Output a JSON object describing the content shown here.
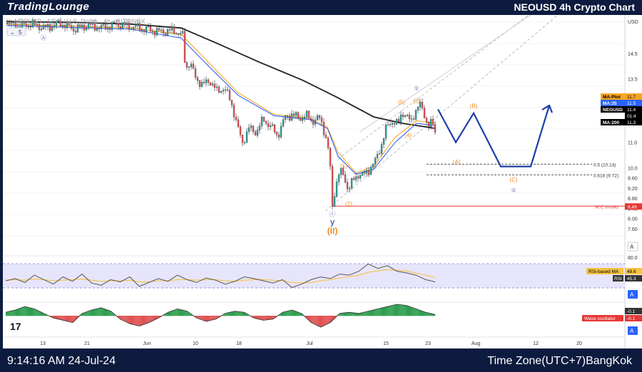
{
  "brand": {
    "logo_text": "TradingLounge",
    "title": "NEOUSD 4h Crypto Chart"
  },
  "footer": {
    "clock": "9:14:16 AM 24-Jul-24",
    "timezone": "Time Zone(UTC+7)BangKok"
  },
  "legend": {
    "symbol_line": "NEOUSD · NEO / U.S. Dollar · 4h · BITFINEX",
    "collapse_count": "5"
  },
  "colors": {
    "up": "#26a69a",
    "down": "#ef5350",
    "ma35": "#2962ff",
    "ma_ptot": "#f6a623",
    "ma200": "#222222",
    "projection": "#1e3fa8",
    "wave_orange": "#f28c28",
    "rsi": "#555555",
    "rsi_ma": "#f5c242",
    "invalid": "#e53935",
    "brand_bg": "#0d1b3e"
  },
  "chart_data": {
    "type": "line",
    "symbol": "NEOUSD",
    "timeframe": "4h",
    "y_axis_label": "USD",
    "ylim": [
      7.6,
      15.9
    ],
    "x_ticks": [
      "13",
      "21",
      "Jun",
      "10",
      "18",
      "Jul",
      "15",
      "23",
      "Aug",
      "12",
      "20"
    ],
    "y_ticks": [
      "14.5",
      "13.5",
      "12.5",
      "11.0",
      "10.0",
      "9.60",
      "9.20",
      "8.80",
      "8.40",
      "8.00",
      "7.60"
    ],
    "price_path": [
      {
        "x": 5,
        "y": 15.7
      },
      {
        "x": 20,
        "y": 15.55
      },
      {
        "x": 40,
        "y": 15.65
      },
      {
        "x": 60,
        "y": 15.5
      },
      {
        "x": 80,
        "y": 15.7
      },
      {
        "x": 100,
        "y": 15.45
      },
      {
        "x": 120,
        "y": 15.6
      },
      {
        "x": 140,
        "y": 15.5
      },
      {
        "x": 160,
        "y": 15.65
      },
      {
        "x": 180,
        "y": 15.55
      },
      {
        "x": 200,
        "y": 15.45
      },
      {
        "x": 220,
        "y": 15.35
      },
      {
        "x": 240,
        "y": 15.4
      },
      {
        "x": 252,
        "y": 15.2
      },
      {
        "x": 256,
        "y": 13.9
      },
      {
        "x": 262,
        "y": 14.15
      },
      {
        "x": 270,
        "y": 13.55
      },
      {
        "x": 280,
        "y": 13.25
      },
      {
        "x": 290,
        "y": 13.45
      },
      {
        "x": 300,
        "y": 13.0
      },
      {
        "x": 310,
        "y": 13.15
      },
      {
        "x": 320,
        "y": 12.6
      },
      {
        "x": 330,
        "y": 11.5
      },
      {
        "x": 336,
        "y": 11.0
      },
      {
        "x": 345,
        "y": 11.55
      },
      {
        "x": 355,
        "y": 11.4
      },
      {
        "x": 365,
        "y": 11.9
      },
      {
        "x": 375,
        "y": 11.65
      },
      {
        "x": 385,
        "y": 11.25
      },
      {
        "x": 395,
        "y": 11.95
      },
      {
        "x": 405,
        "y": 12.1
      },
      {
        "x": 415,
        "y": 11.95
      },
      {
        "x": 425,
        "y": 12.05
      },
      {
        "x": 435,
        "y": 11.85
      },
      {
        "x": 445,
        "y": 11.95
      },
      {
        "x": 452,
        "y": 11.3
      },
      {
        "x": 458,
        "y": 10.45
      },
      {
        "x": 462,
        "y": 8.45
      },
      {
        "x": 466,
        "y": 9.25
      },
      {
        "x": 472,
        "y": 9.85
      },
      {
        "x": 478,
        "y": 9.7
      },
      {
        "x": 484,
        "y": 9.15
      },
      {
        "x": 490,
        "y": 9.45
      },
      {
        "x": 498,
        "y": 9.75
      },
      {
        "x": 506,
        "y": 9.7
      },
      {
        "x": 514,
        "y": 9.95
      },
      {
        "x": 522,
        "y": 10.25
      },
      {
        "x": 530,
        "y": 10.85
      },
      {
        "x": 538,
        "y": 11.6
      },
      {
        "x": 546,
        "y": 11.85
      },
      {
        "x": 554,
        "y": 11.7
      },
      {
        "x": 560,
        "y": 12.2
      },
      {
        "x": 566,
        "y": 12.05
      },
      {
        "x": 572,
        "y": 11.75
      },
      {
        "x": 578,
        "y": 12.25
      },
      {
        "x": 584,
        "y": 12.5
      },
      {
        "x": 590,
        "y": 12.15
      },
      {
        "x": 596,
        "y": 11.7
      },
      {
        "x": 602,
        "y": 11.75
      },
      {
        "x": 606,
        "y": 11.4
      }
    ],
    "ma200_path": [
      {
        "x": 5,
        "y": 15.75
      },
      {
        "x": 100,
        "y": 15.72
      },
      {
        "x": 180,
        "y": 15.65
      },
      {
        "x": 250,
        "y": 15.5
      },
      {
        "x": 300,
        "y": 14.9
      },
      {
        "x": 360,
        "y": 14.15
      },
      {
        "x": 420,
        "y": 13.45
      },
      {
        "x": 470,
        "y": 12.75
      },
      {
        "x": 520,
        "y": 12.0
      },
      {
        "x": 560,
        "y": 11.75
      },
      {
        "x": 606,
        "y": 11.55
      }
    ],
    "ma35_path": [
      {
        "x": 5,
        "y": 15.6
      },
      {
        "x": 180,
        "y": 15.45
      },
      {
        "x": 250,
        "y": 15.1
      },
      {
        "x": 290,
        "y": 13.95
      },
      {
        "x": 330,
        "y": 12.85
      },
      {
        "x": 380,
        "y": 12.05
      },
      {
        "x": 430,
        "y": 11.9
      },
      {
        "x": 455,
        "y": 11.55
      },
      {
        "x": 470,
        "y": 10.45
      },
      {
        "x": 495,
        "y": 9.75
      },
      {
        "x": 520,
        "y": 9.95
      },
      {
        "x": 550,
        "y": 11.0
      },
      {
        "x": 580,
        "y": 11.75
      },
      {
        "x": 606,
        "y": 11.65
      }
    ],
    "ma_ptot_path": [
      {
        "x": 5,
        "y": 15.65
      },
      {
        "x": 180,
        "y": 15.5
      },
      {
        "x": 250,
        "y": 15.25
      },
      {
        "x": 290,
        "y": 14.1
      },
      {
        "x": 330,
        "y": 12.95
      },
      {
        "x": 380,
        "y": 12.1
      },
      {
        "x": 430,
        "y": 11.95
      },
      {
        "x": 455,
        "y": 11.6
      },
      {
        "x": 470,
        "y": 10.6
      },
      {
        "x": 495,
        "y": 9.8
      },
      {
        "x": 520,
        "y": 10.05
      },
      {
        "x": 550,
        "y": 11.2
      },
      {
        "x": 580,
        "y": 11.85
      },
      {
        "x": 606,
        "y": 11.75
      }
    ],
    "projection_path": [
      {
        "x": 610,
        "y": 12.3
      },
      {
        "x": 635,
        "y": 11.0
      },
      {
        "x": 660,
        "y": 12.15
      },
      {
        "x": 698,
        "y": 10.05
      },
      {
        "x": 740,
        "y": 10.05
      },
      {
        "x": 766,
        "y": 12.45
      }
    ],
    "channel_lines": [
      {
        "x1": 452,
        "y1": 8.3,
        "x2": 786,
        "y2": 16.2
      },
      {
        "x1": 470,
        "y1": 10.35,
        "x2": 760,
        "y2": 16.5
      }
    ],
    "fib_levels": [
      {
        "label": "0.5 (10.14)",
        "value": 10.14
      },
      {
        "label": "0.618 (9.72)",
        "value": 9.72
      }
    ],
    "invalidation": {
      "label": "W.C.Invalid",
      "value": 8.49
    },
    "wave_labels": [
      {
        "text": "Ⓐ",
        "x": 57,
        "y": 15.05,
        "color": "#5b6eae"
      },
      {
        "text": "ⓒ",
        "x": 462,
        "y": 8.1,
        "color": "#5b6eae"
      },
      {
        "text": "y",
        "x": 462,
        "y": 7.75,
        "color": "#5b6eae"
      },
      {
        "text": "(II)",
        "x": 462,
        "y": 7.4,
        "color": "#f28c28"
      },
      {
        "text": "(1)",
        "x": 478,
        "y": 10.0,
        "color": "#f28c28"
      },
      {
        "text": "(2)",
        "x": 485,
        "y": 8.5,
        "color": "#f28c28"
      },
      {
        "text": "(3)",
        "x": 580,
        "y": 12.55,
        "color": "#f28c28"
      },
      {
        "text": "(4)",
        "x": 568,
        "y": 11.2,
        "color": "#f28c28"
      },
      {
        "text": "(5)",
        "x": 559,
        "y": 12.5,
        "color": "#f28c28"
      },
      {
        "text": "①",
        "x": 580,
        "y": 13.05,
        "color": "#5b6eae"
      },
      {
        "text": "(A)",
        "x": 636,
        "y": 10.15,
        "color": "#f28c28"
      },
      {
        "text": "(B)",
        "x": 660,
        "y": 12.35,
        "color": "#f28c28"
      },
      {
        "text": "(C)",
        "x": 716,
        "y": 9.45,
        "color": "#f28c28"
      },
      {
        "text": "②",
        "x": 716,
        "y": 9.05,
        "color": "#5b6eae"
      }
    ],
    "price_tags": [
      {
        "label": "MA-Ptot",
        "value": "11.7",
        "bg": "#f6a623",
        "fg": "#000000"
      },
      {
        "label": "MA:35",
        "value": "11.5",
        "bg": "#2962ff",
        "fg": "#ffffff"
      },
      {
        "label": "NEOUSD",
        "value": "11.4",
        "bg": "#000000",
        "fg": "#ffffff"
      },
      {
        "label": "",
        "value": "01:4",
        "bg": "#000000",
        "fg": "#ffffff"
      },
      {
        "label": "MA:200",
        "value": "11.3",
        "bg": "#000000",
        "fg": "#ffffff"
      }
    ],
    "rsi": {
      "label": "RSI",
      "ma_label": "RSI-based MA",
      "value": "45.3",
      "ma_value": "48.6",
      "tick_label": "80.0",
      "series": [
        48,
        52,
        45,
        58,
        50,
        42,
        55,
        47,
        60,
        44,
        40,
        50,
        46,
        55,
        38,
        45,
        52,
        47,
        58,
        50,
        45,
        53,
        49,
        42,
        47,
        55,
        52,
        48,
        44,
        50,
        36,
        42,
        50,
        55,
        52,
        60,
        58,
        65,
        78,
        70,
        75,
        65,
        62,
        58,
        50,
        46
      ],
      "ma_series": [
        49,
        50,
        49,
        51,
        50,
        48,
        49,
        50,
        51,
        49,
        47,
        48,
        48,
        49,
        46,
        46,
        48,
        48,
        50,
        50,
        49,
        50,
        50,
        48,
        47,
        49,
        50,
        50,
        49,
        48,
        45,
        44,
        45,
        48,
        50,
        53,
        55,
        58,
        63,
        66,
        68,
        67,
        65,
        62,
        58,
        54
      ]
    },
    "wave_oscillator": {
      "label": "Wave oscillator",
      "values": [
        "-0.1",
        "-0.1"
      ],
      "bars": [
        0.3,
        0.5,
        0.8,
        0.6,
        0.2,
        -0.2,
        -0.4,
        -0.6,
        0.2,
        0.5,
        0.7,
        0.4,
        -0.3,
        -0.7,
        -0.9,
        -0.6,
        -0.2,
        0.3,
        0.6,
        0.4,
        -0.2,
        -0.5,
        -0.3,
        0.2,
        0.4,
        0.3,
        -0.2,
        -0.4,
        -0.3,
        0.3,
        0.5,
        0.2,
        -0.6,
        -1.0,
        -0.6,
        0.2,
        0.3,
        0.2,
        0.4,
        0.6,
        0.8,
        1.0,
        0.9,
        0.6,
        0.3,
        0.1
      ]
    }
  }
}
